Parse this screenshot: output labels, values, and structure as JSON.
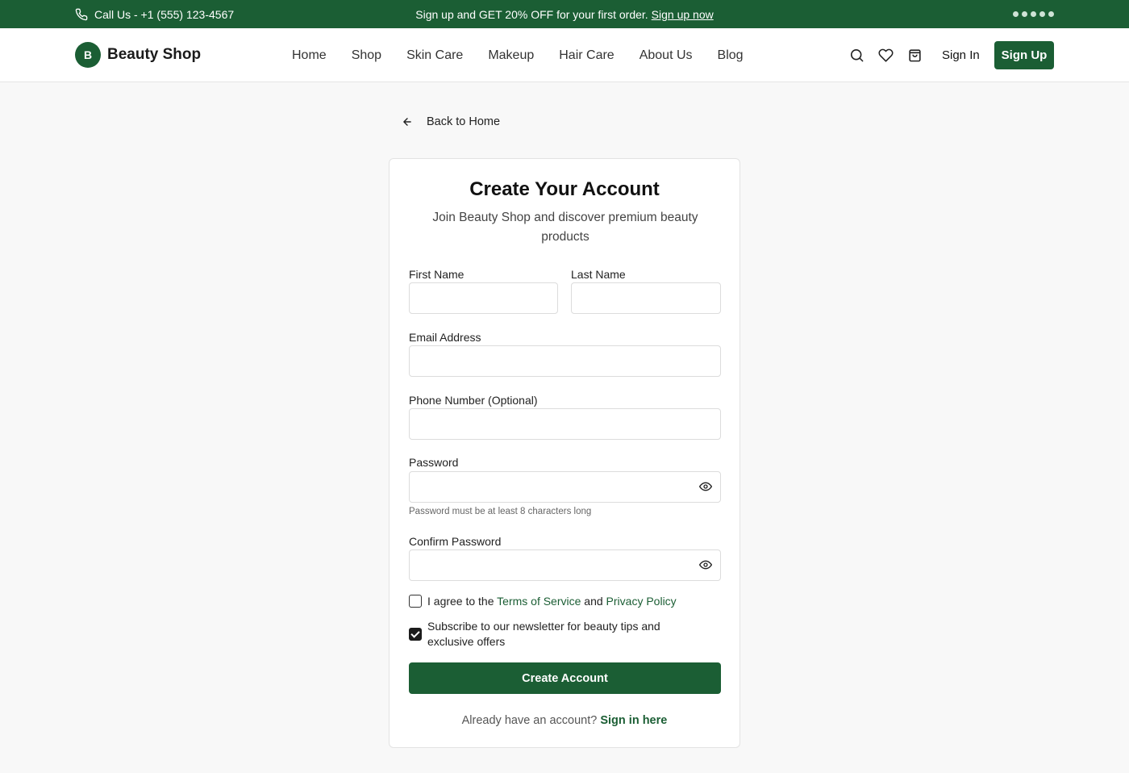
{
  "topbar": {
    "call_text": "Call Us - +1 (555) 123-4567",
    "promo_text": "Sign up and GET 20% OFF for your first order.",
    "promo_link": "Sign up now",
    "phone_icon": "phone-icon"
  },
  "header": {
    "logo_letter": "B",
    "logo_name": "Beauty Shop",
    "nav": [
      "Home",
      "Shop",
      "Skin Care",
      "Makeup",
      "Hair Care",
      "About Us",
      "Blog"
    ],
    "icons": [
      "search-icon",
      "heart-icon",
      "shopping-bag-icon"
    ],
    "signin_label": "Sign In",
    "signup_label": "Sign Up"
  },
  "back": {
    "label": "Back to Home",
    "icon": "arrow-left-icon"
  },
  "form": {
    "title": "Create Your Account",
    "subtitle": "Join Beauty Shop and discover premium beauty products",
    "first_name_label": "First Name",
    "last_name_label": "Last Name",
    "email_label": "Email Address",
    "phone_label": "Phone Number (Optional)",
    "password_label": "Password",
    "password_hint": "Password must be at least 8 characters long",
    "confirm_label": "Confirm Password",
    "terms_prefix": "I agree to the",
    "terms_link": "Terms of Service",
    "terms_and": "and",
    "privacy_link": "Privacy Policy",
    "terms_checked": false,
    "newsletter_text": "Subscribe to our newsletter for beauty tips and exclusive offers",
    "newsletter_checked": true,
    "submit_label": "Create Account",
    "footer_text": "Already have an account?",
    "footer_link": "Sign in here"
  },
  "colors": {
    "brand": "#1b5e34",
    "background": "#f8f8f8"
  }
}
